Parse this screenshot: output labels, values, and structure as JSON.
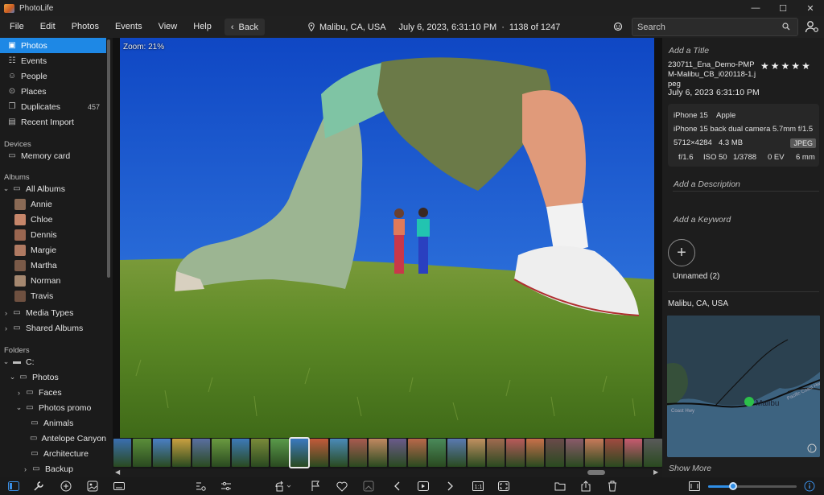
{
  "window": {
    "title": "PhotoLife",
    "controls": [
      "—",
      "☐",
      "✕"
    ]
  },
  "menu": {
    "items": [
      "File",
      "Edit",
      "Photos",
      "Events",
      "View",
      "Help"
    ],
    "back_label": "Back"
  },
  "info": {
    "location": "Malibu, CA, USA",
    "datetime": "July 6, 2023, 6:31:10 PM",
    "separator": "·",
    "position": "1138 of 1247"
  },
  "search": {
    "placeholder": "Search"
  },
  "sidebar": {
    "library": [
      {
        "label": "Photos",
        "icon": "photos-icon",
        "active": true
      },
      {
        "label": "Events",
        "icon": "events-icon"
      },
      {
        "label": "People",
        "icon": "people-icon"
      },
      {
        "label": "Places",
        "icon": "places-icon"
      },
      {
        "label": "Duplicates",
        "icon": "duplicates-icon",
        "count": "457"
      },
      {
        "label": "Recent Import",
        "icon": "recent-import-icon"
      }
    ],
    "devices_header": "Devices",
    "devices": [
      {
        "label": "Memory card",
        "icon": "memory-card-icon"
      }
    ],
    "albums_header": "Albums",
    "all_albums": "All Albums",
    "people_albums": [
      {
        "label": "Annie",
        "color": "#8a6a55"
      },
      {
        "label": "Chloe",
        "color": "#c6866a"
      },
      {
        "label": "Dennis",
        "color": "#9a6650"
      },
      {
        "label": "Margie",
        "color": "#b07a62"
      },
      {
        "label": "Martha",
        "color": "#7a5a48"
      },
      {
        "label": "Norman",
        "color": "#a58870"
      },
      {
        "label": "Travis",
        "color": "#6e5040"
      }
    ],
    "media_types": "Media Types",
    "shared_albums": "Shared Albums",
    "folders_header": "Folders",
    "folders": [
      {
        "label": "C:",
        "depth": 0,
        "chevron": "down",
        "icon": "drive-icon"
      },
      {
        "label": "Photos",
        "depth": 1,
        "chevron": "down"
      },
      {
        "label": "Faces",
        "depth": 2,
        "chevron": "right"
      },
      {
        "label": "Photos promo",
        "depth": 2,
        "chevron": "down"
      },
      {
        "label": "Animals",
        "depth": 3
      },
      {
        "label": "Antelope Canyon",
        "depth": 3
      },
      {
        "label": "Architecture",
        "depth": 3
      },
      {
        "label": "Backup",
        "depth": 2,
        "chevron": "right"
      }
    ]
  },
  "viewer": {
    "zoom": "Zoom: 21%"
  },
  "filmstrip": {
    "colors": [
      "#3a6fb0",
      "#5b8e3a",
      "#4a7fc4",
      "#c9a040",
      "#5a6fa0",
      "#6a9a40",
      "#3d7ab8",
      "#7a8a3a",
      "#5a9a4a",
      "#3a7ac0",
      "#c25a3a",
      "#4a8ab8",
      "#a85a50",
      "#c08860",
      "#6a5a8a",
      "#b8684a",
      "#4a8a5a",
      "#5a7ab0",
      "#c09060",
      "#a06a50",
      "#b85a5a",
      "#c8704a",
      "#6a4a4a",
      "#8a5a6a",
      "#c87a5a",
      "#a04a40",
      "#c85a70",
      "#5a5a5a"
    ],
    "selected_index": 9
  },
  "details": {
    "title_placeholder": "Add a Title",
    "filename": "230711_Ena_Demo-PMPM-Malibu_CB_i020118-1.jpeg",
    "rating": 5,
    "date": "July 6, 2023",
    "time": "6:31:10 PM",
    "camera_model": "iPhone 15",
    "camera_make": "Apple",
    "lens": "iPhone 15 back dual camera 5.7mm f/1.5",
    "dimensions": "5712×4284",
    "size": "4.3 MB",
    "format": "JPEG",
    "aperture": "f/1.6",
    "iso": "ISO 50",
    "shutter": "1/3788",
    "ev": "0 EV",
    "focal": "6 mm",
    "description_placeholder": "Add a Description",
    "keyword_placeholder": "Add a Keyword",
    "face_label": "Unnamed (2)",
    "place": "Malibu, CA, USA",
    "map_label": "Malibu",
    "map_road": "Coast Hwy",
    "map_coast": "Pacific Coast Hwy",
    "show_more": "Show More"
  },
  "colors": {
    "accent": "#1e88e5",
    "sky": "#1e5fd0",
    "grass": "#5e8a2a"
  }
}
